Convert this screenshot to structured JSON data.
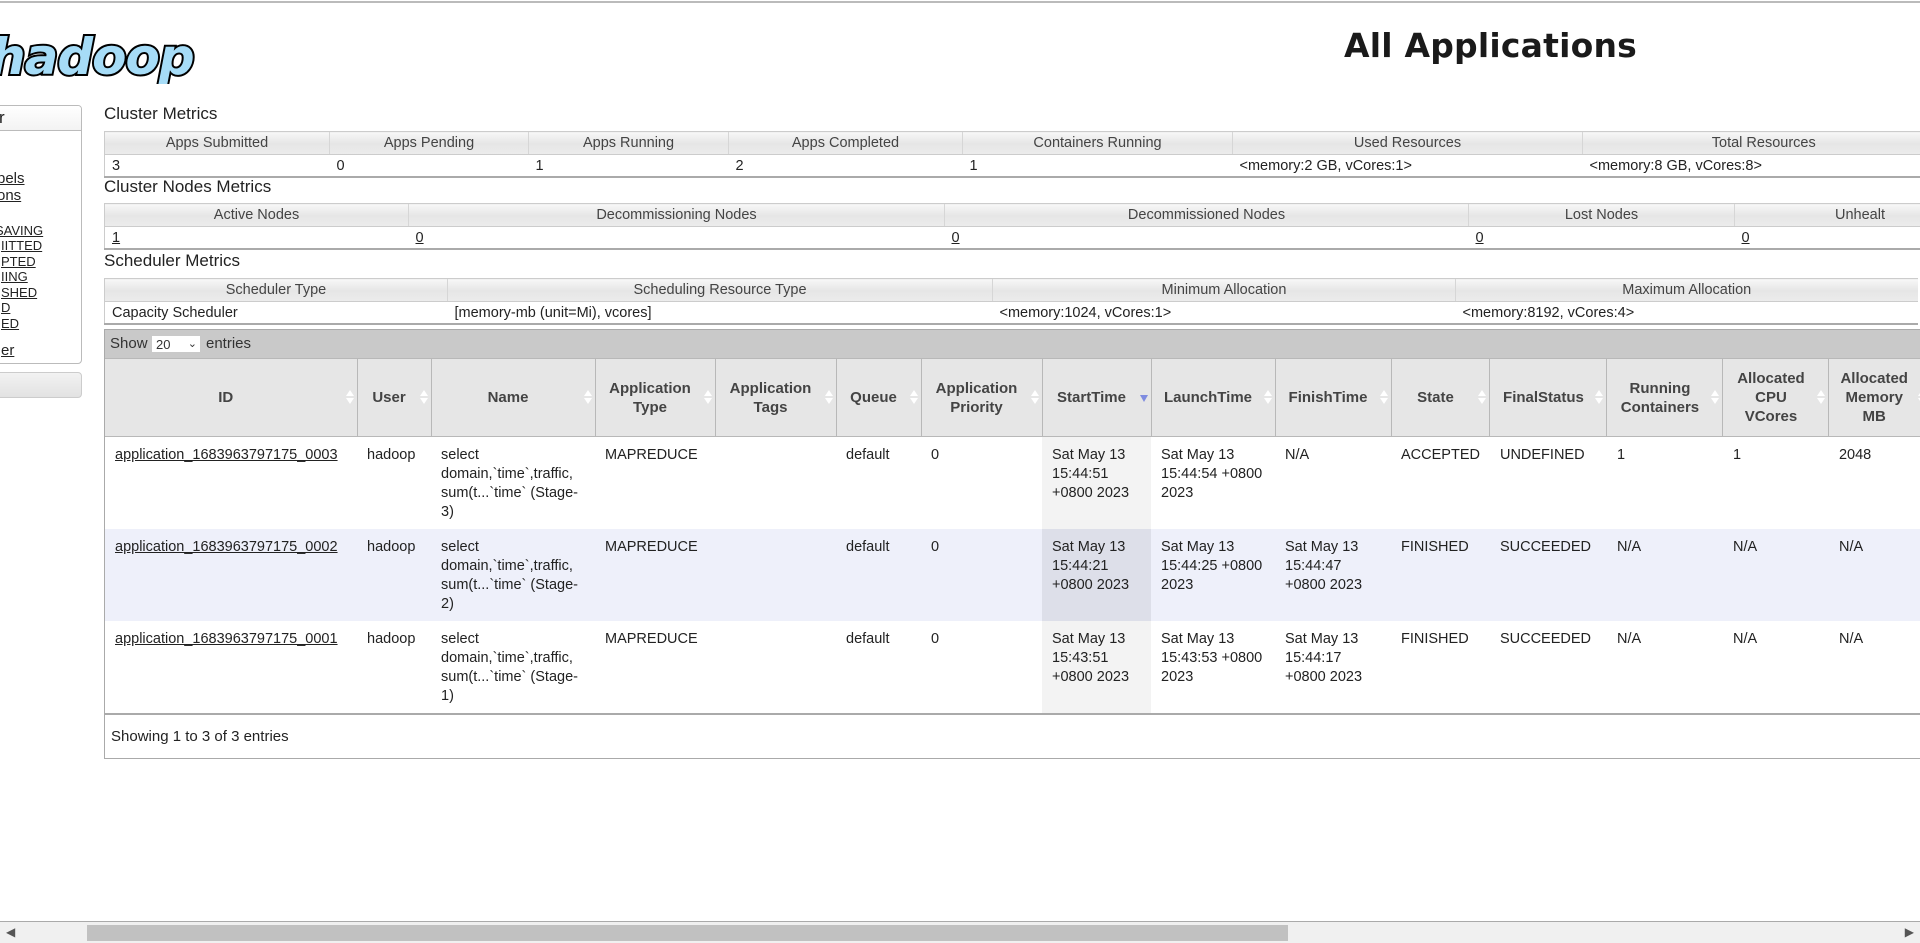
{
  "header": {
    "logo_text": "hadoop",
    "title": "All Applications"
  },
  "sidebar": {
    "heading": "r",
    "items": [
      {
        "label": "bels"
      },
      {
        "label": "ons"
      },
      {
        "label": " SAVING"
      },
      {
        "label": "IITTED"
      },
      {
        "label": "PTED"
      },
      {
        "label": "IING"
      },
      {
        "label": "SHED"
      },
      {
        "label": "D"
      },
      {
        "label": "ED"
      },
      {
        "label": "er"
      }
    ]
  },
  "cluster_metrics": {
    "title": "Cluster Metrics",
    "headers": [
      "Apps Submitted",
      "Apps Pending",
      "Apps Running",
      "Apps Completed",
      "Containers Running",
      "Used Resources",
      "Total Resources"
    ],
    "values": [
      "3",
      "0",
      "1",
      "2",
      "1",
      "<memory:2 GB, vCores:1>",
      "<memory:8 GB, vCores:8>"
    ]
  },
  "cluster_nodes_metrics": {
    "title": "Cluster Nodes Metrics",
    "headers": [
      "Active Nodes",
      "Decommissioning Nodes",
      "Decommissioned Nodes",
      "Lost Nodes",
      "Unhealt"
    ],
    "values": [
      "1",
      "0",
      "0",
      "0",
      "0"
    ]
  },
  "scheduler_metrics": {
    "title": "Scheduler Metrics",
    "headers": [
      "Scheduler Type",
      "Scheduling Resource Type",
      "Minimum Allocation",
      "Maximum Allocation"
    ],
    "values": [
      "Capacity Scheduler",
      "[memory-mb (unit=Mi), vcores]",
      "<memory:1024, vCores:1>",
      "<memory:8192, vCores:4>"
    ]
  },
  "apps_table": {
    "show_label": "Show",
    "entries_label": "entries",
    "page_size": "20",
    "sorted_column": "StartTime",
    "sort_direction": "descending",
    "columns": [
      "ID",
      "User",
      "Name",
      "Application Type",
      "Application Tags",
      "Queue",
      "Application Priority",
      "StartTime",
      "LaunchTime",
      "FinishTime",
      "State",
      "FinalStatus",
      "Running Containers",
      "Allocated CPU VCores",
      "Allocated Memory MB"
    ],
    "rows": [
      {
        "id": "application_1683963797175_0003",
        "user": "hadoop",
        "name": "select domain,`time`,traffic, sum(t...`time` (Stage-3)",
        "type": "MAPREDUCE",
        "tags": "",
        "queue": "default",
        "priority": "0",
        "start": "Sat May 13 15:44:51 +0800 2023",
        "launch": "Sat May 13 15:44:54 +0800 2023",
        "finish": "N/A",
        "state": "ACCEPTED",
        "final_status": "UNDEFINED",
        "running_containers": "1",
        "alloc_cpu": "1",
        "alloc_mem": "2048"
      },
      {
        "id": "application_1683963797175_0002",
        "user": "hadoop",
        "name": "select domain,`time`,traffic, sum(t...`time` (Stage-2)",
        "type": "MAPREDUCE",
        "tags": "",
        "queue": "default",
        "priority": "0",
        "start": "Sat May 13 15:44:21 +0800 2023",
        "launch": "Sat May 13 15:44:25 +0800 2023",
        "finish": "Sat May 13 15:44:47 +0800 2023",
        "state": "FINISHED",
        "final_status": "SUCCEEDED",
        "running_containers": "N/A",
        "alloc_cpu": "N/A",
        "alloc_mem": "N/A"
      },
      {
        "id": "application_1683963797175_0001",
        "user": "hadoop",
        "name": "select domain,`time`,traffic, sum(t...`time` (Stage-1)",
        "type": "MAPREDUCE",
        "tags": "",
        "queue": "default",
        "priority": "0",
        "start": "Sat May 13 15:43:51 +0800 2023",
        "launch": "Sat May 13 15:43:53 +0800 2023",
        "finish": "Sat May 13 15:44:17 +0800 2023",
        "state": "FINISHED",
        "final_status": "SUCCEEDED",
        "running_containers": "N/A",
        "alloc_cpu": "N/A",
        "alloc_mem": "N/A"
      }
    ],
    "footer": "Showing 1 to 3 of 3 entries"
  },
  "colors": {
    "logo_fill": "#a6dcf7",
    "even_row": "#eef0fa",
    "sorted_col": "#f3f3f3",
    "sort_arrow": "#7f8ce0",
    "toolbar": "#c9c9c9"
  }
}
